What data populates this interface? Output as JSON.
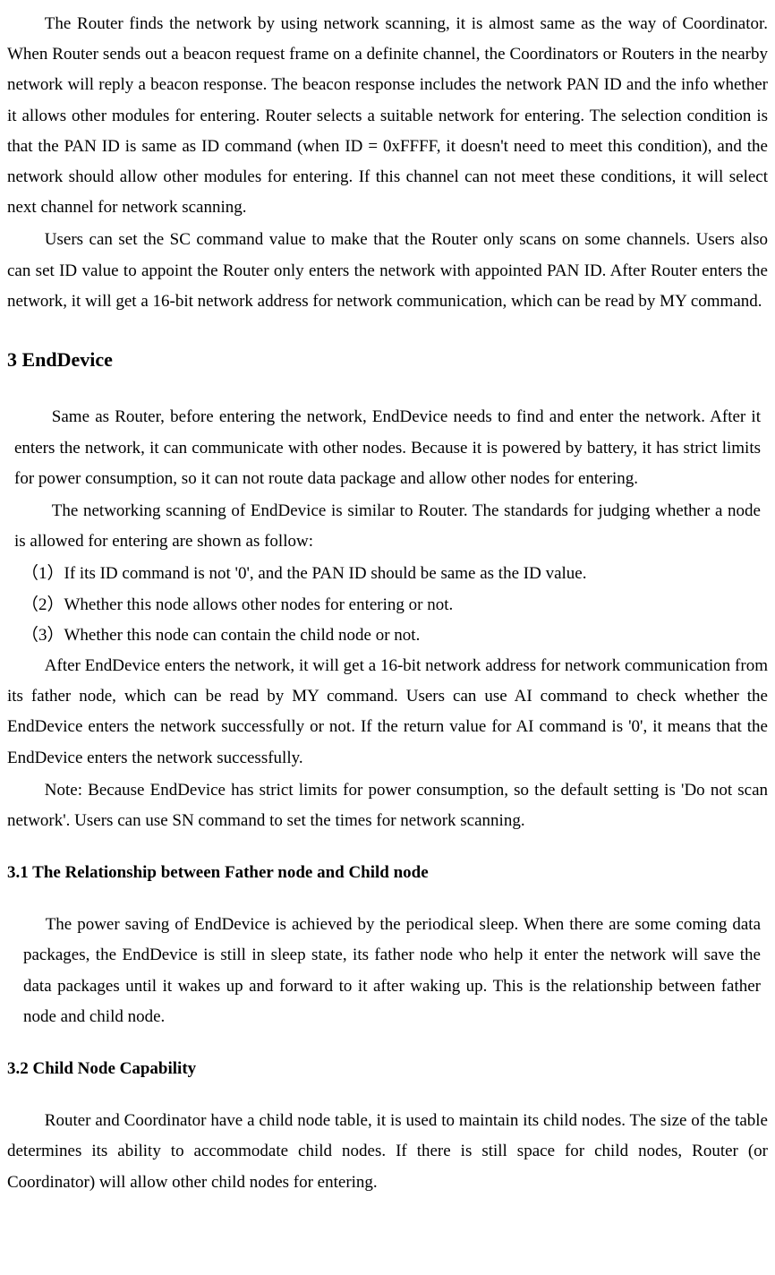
{
  "para1": "The Router finds the network by using network scanning, it is almost same as the way of Coordinator. When Router sends out a beacon request frame on a definite channel, the Coordinators or Routers in the nearby network will reply a beacon response. The beacon response includes the network PAN ID and the info whether it allows other modules for entering. Router selects a suitable network for entering. The selection condition is that the PAN ID is same as ID command (when ID = 0xFFFF, it doesn't need to meet this condition), and the network should allow other modules for entering. If this channel can not meet these conditions, it will select next channel for network scanning.",
  "para2": "Users can set the SC command value to make that the Router only scans on some channels. Users also can set ID value to appoint the Router only enters the network with appointed PAN ID. After Router enters the network, it will get a 16-bit network address for network communication, which can be read by MY command.",
  "heading3": "3 EndDevice",
  "para3": "Same as Router, before entering the network, EndDevice needs to find and enter the network. After it enters the network, it can communicate with other nodes. Because it is powered by battery, it has strict limits for power consumption, so it can not route data package and allow other nodes for entering.",
  "para4": "The networking scanning of EndDevice is similar to Router. The standards for judging whether a node is allowed for entering are shown as follow:",
  "list": {
    "i1": "（1）If its ID command is not '0', and the PAN ID should be same as the ID value.",
    "i2": "（2）Whether this node allows other nodes for entering or not.",
    "i3": "（3）Whether this node can contain the child node or not."
  },
  "para5": "After EndDevice enters the network, it will get a 16-bit network address for network communication from its father node, which can be read by MY command. Users can use AI command to check whether the EndDevice enters the network successfully or not. If the return value for AI command is '0', it means that the EndDevice enters the network successfully.",
  "para6": "Note: Because EndDevice has strict limits for power consumption, so the default setting is 'Do not scan network'. Users can use SN command to set the times for network scanning.",
  "heading31": "3.1 The Relationship between Father node and Child node",
  "para7": "The power saving of EndDevice is achieved by the periodical sleep. When there are some coming data packages, the EndDevice is still in sleep state, its father node who help it enter the network will save the data packages until it wakes up and forward to it after waking up. This is the relationship between father node and child node.",
  "heading32": "3.2 Child Node Capability",
  "para8": "Router and Coordinator have a child node table, it is used to maintain its child nodes. The size of the table determines its ability to accommodate child nodes. If there is still space for child nodes, Router (or Coordinator) will allow other child nodes for entering."
}
